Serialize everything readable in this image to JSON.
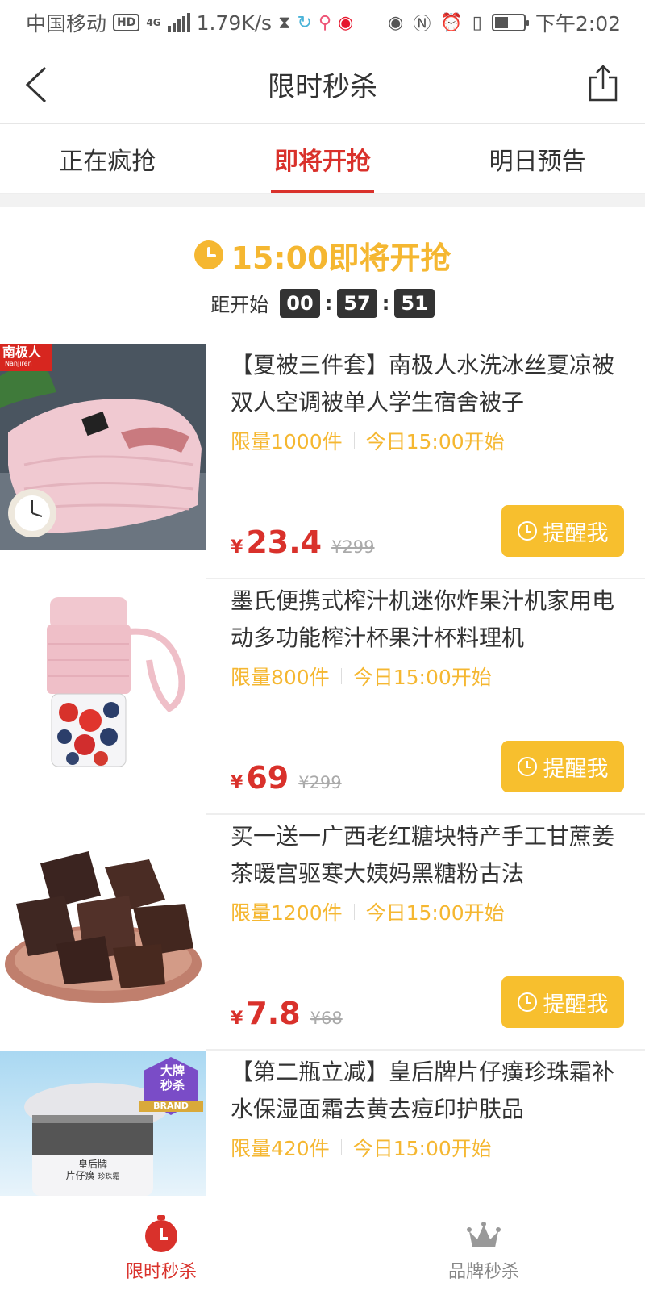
{
  "status_bar": {
    "carrier": "中国移动",
    "hd": "HD",
    "network": "4G",
    "speed": "1.79K/s",
    "time": "下午2:02"
  },
  "nav": {
    "title": "限时秒杀"
  },
  "tabs": [
    {
      "label": "正在疯抢",
      "active": false
    },
    {
      "label": "即将开抢",
      "active": true
    },
    {
      "label": "明日预告",
      "active": false
    }
  ],
  "session": {
    "title": "15:00即将开抢",
    "countdown_label": "距开始",
    "hours": "00",
    "minutes": "57",
    "seconds": "51"
  },
  "products": [
    {
      "title": "【夏被三件套】南极人水洗冰丝夏凉被双人空调被单人学生宿舍被子",
      "limit": "限量1000件",
      "start": "今日15:00开始",
      "price": "23.4",
      "original": "¥299",
      "button": "提醒我",
      "badge": "南极人",
      "badge_sub": "NanJiren"
    },
    {
      "title": "墨氏便携式榨汁机迷你炸果汁机家用电动多功能榨汁杯果汁杯料理机",
      "limit": "限量800件",
      "start": "今日15:00开始",
      "price": "69",
      "original": "¥299",
      "button": "提醒我"
    },
    {
      "title": "买一送一广西老红糖块特产手工甘蔗姜茶暖宫驱寒大姨妈黑糖粉古法",
      "limit": "限量1200件",
      "start": "今日15:00开始",
      "price": "7.8",
      "original": "¥68",
      "button": "提醒我"
    },
    {
      "title": "【第二瓶立减】皇后牌片仔癀珍珠霜补水保湿面霜去黄去痘印护肤品",
      "limit": "限量420件",
      "start": "今日15:00开始",
      "price": "",
      "original": "",
      "button": "",
      "badge_line1": "大牌",
      "badge_line2": "秒杀",
      "badge_line3": "BRAND",
      "jar_label": "皇后牌",
      "jar_label2": "片仔癀",
      "jar_label3": "珍珠霜"
    }
  ],
  "currency": "¥",
  "bottom_tabs": [
    {
      "label": "限时秒杀",
      "active": true
    },
    {
      "label": "品牌秒杀",
      "active": false
    }
  ]
}
